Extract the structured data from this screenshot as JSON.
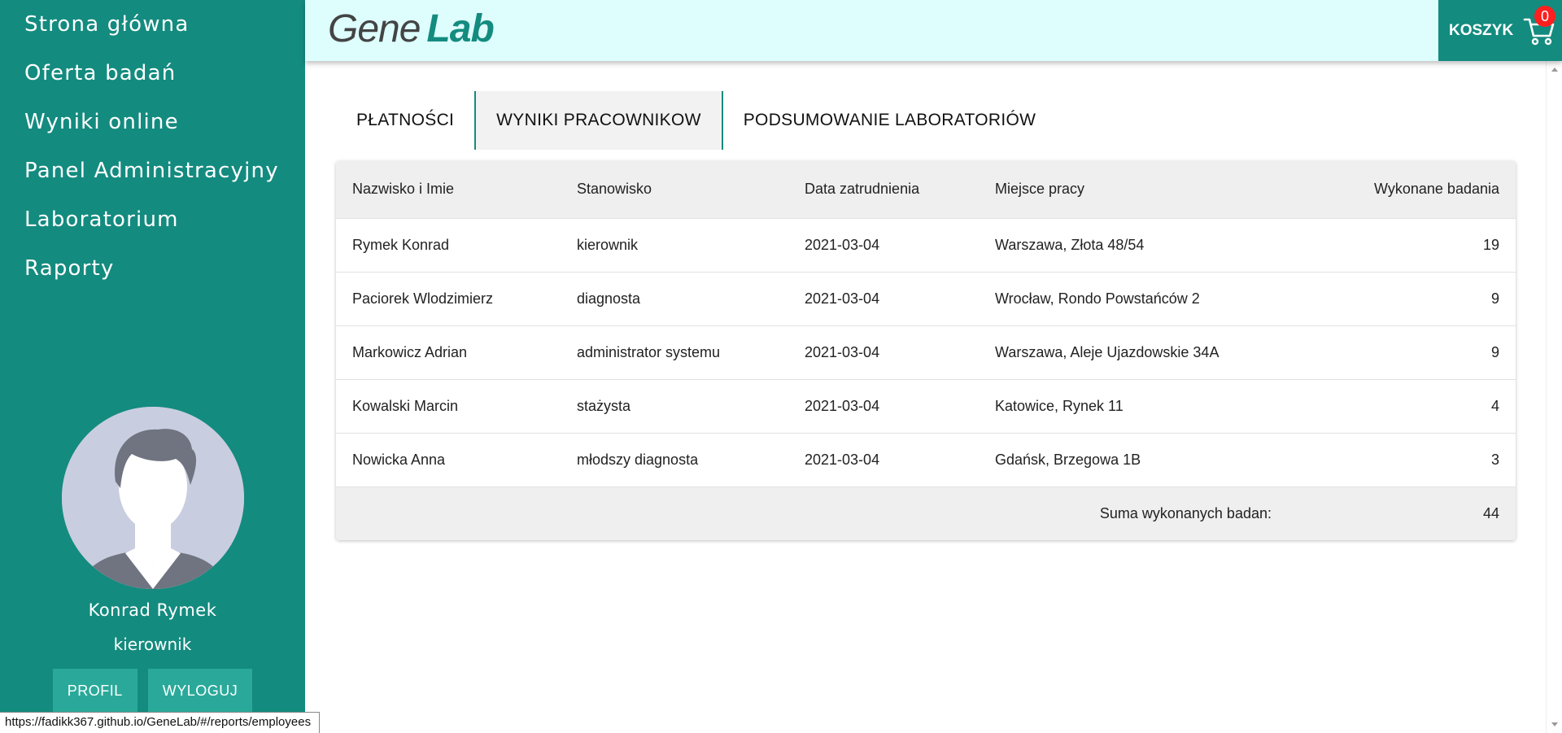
{
  "sidebar": {
    "nav": [
      {
        "label": "Strona główna"
      },
      {
        "label": "Oferta badań"
      },
      {
        "label": "Wyniki online"
      },
      {
        "label": "Panel Administracyjny"
      },
      {
        "label": "Laboratorium"
      },
      {
        "label": "Raporty"
      }
    ],
    "user": {
      "name": "Konrad Rymek",
      "role": "kierownik",
      "profile_button": "PROFIL",
      "logout_button": "WYLOGUJ"
    }
  },
  "header": {
    "logo_part1": "Gene",
    "logo_part2": "Lab",
    "cart_label": "KOSZYK",
    "cart_count": "0"
  },
  "tabs": [
    {
      "label": "PŁATNOŚCI",
      "active": false
    },
    {
      "label": "WYNIKI PRACOWNIKOW",
      "active": true
    },
    {
      "label": "PODSUMOWANIE LABORATORIÓW",
      "active": false
    }
  ],
  "table": {
    "headers": [
      "Nazwisko i Imie",
      "Stanowisko",
      "Data zatrudnienia",
      "Miejsce pracy",
      "Wykonane badania"
    ],
    "rows": [
      [
        "Rymek Konrad",
        "kierownik",
        "2021-03-04",
        "Warszawa, Złota 48/54",
        "19"
      ],
      [
        "Paciorek Wlodzimierz",
        "diagnosta",
        "2021-03-04",
        "Wrocław, Rondo Powstańców 2",
        "9"
      ],
      [
        "Markowicz Adrian",
        "administrator systemu",
        "2021-03-04",
        "Warszawa, Aleje Ujazdowskie 34A",
        "9"
      ],
      [
        "Kowalski Marcin",
        "stażysta",
        "2021-03-04",
        "Katowice, Rynek 11",
        "4"
      ],
      [
        "Nowicka Anna",
        "młodszy diagnosta",
        "2021-03-04",
        "Gdańsk, Brzegowa 1B",
        "3"
      ]
    ],
    "footer_label": "Suma wykonanych badan:",
    "footer_total": "44"
  },
  "status_url": "https://fadikk367.github.io/GeneLab/#/reports/employees",
  "colors": {
    "primary": "#148b7f",
    "header_bg": "#defefe",
    "badge": "#ff1f1f"
  }
}
